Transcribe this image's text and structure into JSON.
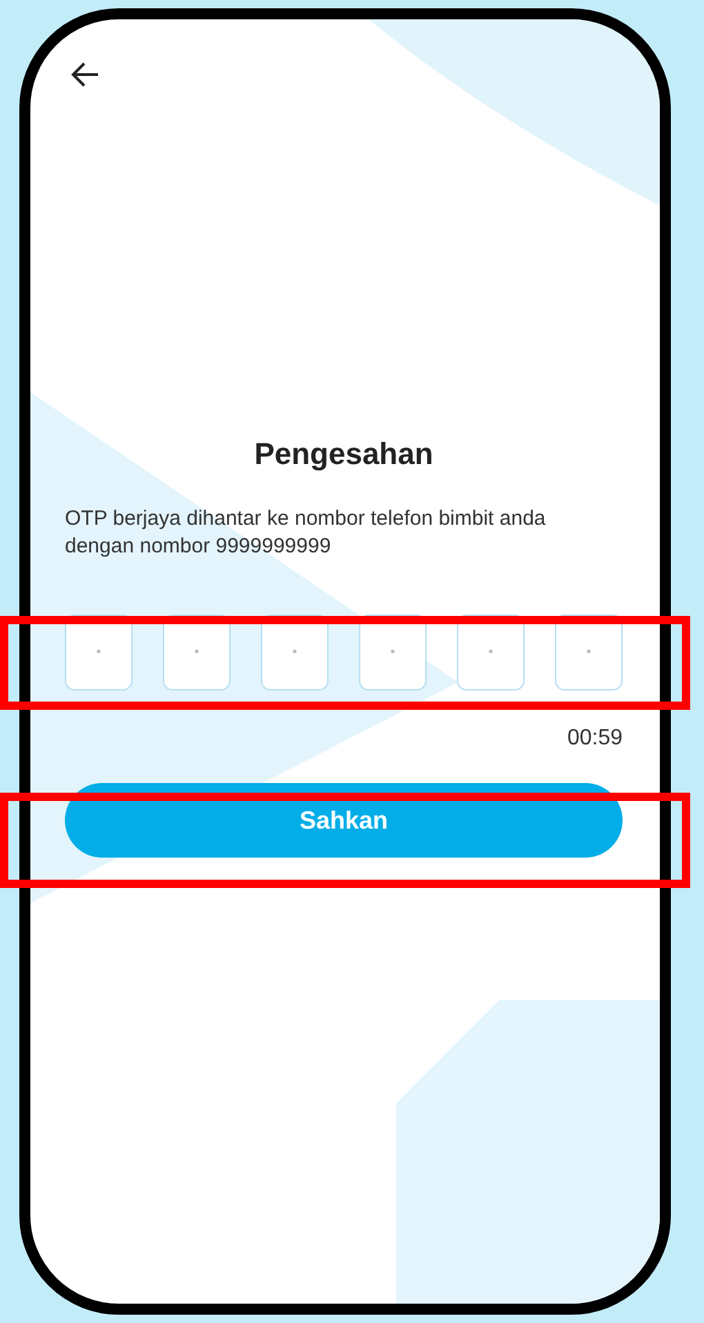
{
  "screen": {
    "title": "Pengesahan",
    "message": "OTP berjaya dihantar ke nombor telefon bimbit anda dengan nombor 9999999999"
  },
  "otp_fields": [
    {
      "placeholder": "•"
    },
    {
      "placeholder": "•"
    },
    {
      "placeholder": "•"
    },
    {
      "placeholder": "•"
    },
    {
      "placeholder": "•"
    },
    {
      "placeholder": "•"
    }
  ],
  "timer": "00:59",
  "button": {
    "label": "Sahkan"
  }
}
